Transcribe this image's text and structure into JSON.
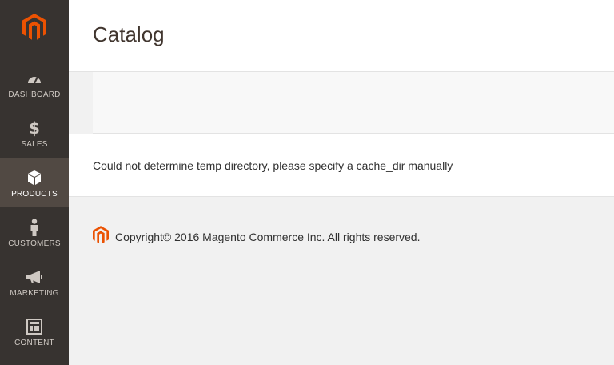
{
  "sidebar": {
    "logo_icon": "magento-logo-icon",
    "items": [
      {
        "label": "DASHBOARD",
        "icon": "dashboard-icon",
        "active": false
      },
      {
        "label": "SALES",
        "icon": "dollar-icon",
        "active": false
      },
      {
        "label": "PRODUCTS",
        "icon": "cube-icon",
        "active": true
      },
      {
        "label": "CUSTOMERS",
        "icon": "person-icon",
        "active": false
      },
      {
        "label": "MARKETING",
        "icon": "megaphone-icon",
        "active": false
      },
      {
        "label": "CONTENT",
        "icon": "layout-icon",
        "active": false
      }
    ]
  },
  "header": {
    "title": "Catalog"
  },
  "main": {
    "error_message": "Could not determine temp directory, please specify a cache_dir manually"
  },
  "footer": {
    "copyright": "Copyright© 2016 Magento Commerce Inc. All rights reserved."
  },
  "colors": {
    "sidebar_bg": "#373330",
    "sidebar_active": "#514943",
    "brand_orange": "#eb5202"
  }
}
